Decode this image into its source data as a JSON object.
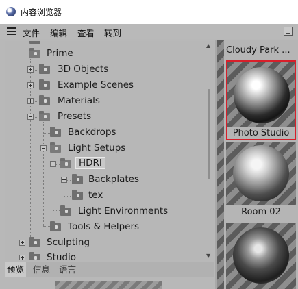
{
  "window": {
    "title": "内容浏览器",
    "icon": "cinema4d-logo-icon"
  },
  "menu": {
    "icon": "hamburger-icon",
    "file": "文件",
    "edit": "编辑",
    "view": "查看",
    "goto": "转到",
    "window_button_icon": "minimize-panel-icon"
  },
  "tree": {
    "items": [
      {
        "label": "Prime",
        "icon": "folder-open-icon",
        "expanded": true
      },
      {
        "label": "3D Objects",
        "icon": "locked-folder-icon",
        "expanded": false
      },
      {
        "label": "Example Scenes",
        "icon": "locked-folder-icon",
        "expanded": false
      },
      {
        "label": "Materials",
        "icon": "locked-folder-icon",
        "expanded": false
      },
      {
        "label": "Presets",
        "icon": "locked-folder-icon",
        "expanded": true
      },
      {
        "label": "Backdrops",
        "icon": "locked-folder-icon"
      },
      {
        "label": "Light Setups",
        "icon": "locked-folder-icon",
        "expanded": true
      },
      {
        "label": "HDRI",
        "icon": "locked-folder-icon",
        "expanded": true,
        "selected": true
      },
      {
        "label": "Backplates",
        "icon": "locked-folder-icon",
        "expanded": false
      },
      {
        "label": "tex",
        "icon": "locked-folder-icon"
      },
      {
        "label": "Light Environments",
        "icon": "locked-folder-icon"
      },
      {
        "label": "Tools & Helpers",
        "icon": "locked-folder-icon"
      },
      {
        "label": "Sculpting",
        "icon": "locked-folder-icon",
        "expanded": false
      },
      {
        "label": "Studio",
        "icon": "locked-folder-icon",
        "expanded": false
      }
    ]
  },
  "tabs": {
    "preview": "预览",
    "info": "信息",
    "language": "语言"
  },
  "thumbnails": {
    "cloudy_park": "Cloudy Park ...",
    "photo_studio": "Photo Studio",
    "room02": "Room 02",
    "selected_border_color": "#d81f2a"
  }
}
